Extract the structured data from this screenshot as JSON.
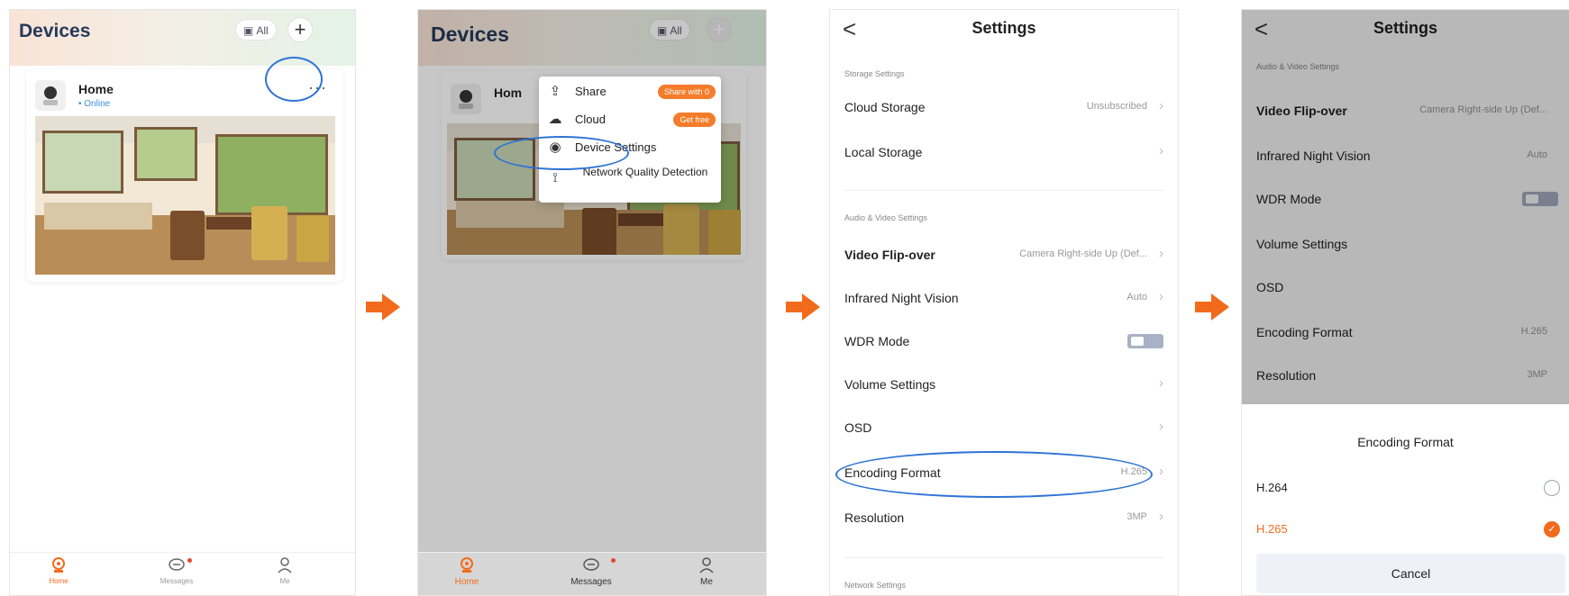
{
  "screen1": {
    "title": "Devices",
    "filter_label": "All",
    "add_label": "+",
    "device": {
      "name": "Home",
      "status": "• Online",
      "more": "···"
    },
    "tabs": [
      {
        "label": "Home"
      },
      {
        "label": "Messages"
      },
      {
        "label": "Me"
      }
    ]
  },
  "screen2": {
    "title": "Devices",
    "filter_label": "All",
    "device_name": "Hom",
    "menu": [
      {
        "label": "Share",
        "badge": "Share with 0"
      },
      {
        "label": "Cloud",
        "badge": "Get free"
      },
      {
        "label": "Device Settings"
      },
      {
        "label": "Network Quality Detection"
      }
    ],
    "tabs": [
      {
        "label": "Home"
      },
      {
        "label": "Messages"
      },
      {
        "label": "Me"
      }
    ]
  },
  "screen3": {
    "back": "<",
    "title": "Settings",
    "storage_header": "Storage Settings",
    "cloud_storage": {
      "label": "Cloud Storage",
      "value": "Unsubscribed"
    },
    "local_storage": {
      "label": "Local Storage"
    },
    "av_header": "Audio & Video Settings",
    "video_flip": {
      "label": "Video Flip-over",
      "value": "Camera Right-side Up (Def..."
    },
    "infrared": {
      "label": "Infrared Night Vision",
      "value": "Auto"
    },
    "wdr": {
      "label": "WDR Mode"
    },
    "volume": {
      "label": "Volume Settings"
    },
    "osd": {
      "label": "OSD"
    },
    "encoding": {
      "label": "Encoding Format",
      "value": "H.265"
    },
    "resolution": {
      "label": "Resolution",
      "value": "3MP"
    },
    "network_header": "Network Settings"
  },
  "screen4": {
    "back": "<",
    "title": "Settings",
    "av_header": "Audio & Video Settings",
    "video_flip": {
      "label": "Video Flip-over",
      "value": "Camera Right-side Up (Def..."
    },
    "infrared": {
      "label": "Infrared Night Vision",
      "value": "Auto"
    },
    "wdr": {
      "label": "WDR Mode"
    },
    "volume": {
      "label": "Volume Settings"
    },
    "osd": {
      "label": "OSD"
    },
    "encoding": {
      "label": "Encoding Format",
      "value": "H.265"
    },
    "resolution": {
      "label": "Resolution",
      "value": "3MP"
    },
    "sheet": {
      "title": "Encoding Format",
      "options": [
        {
          "label": "H.264",
          "selected": false
        },
        {
          "label": "H.265",
          "selected": true
        }
      ],
      "cancel": "Cancel"
    }
  },
  "colors": {
    "accent": "#f26b1d",
    "highlight": "#2f73d6",
    "title_dark": "#263a5b"
  },
  "icons": [
    "camera-icon",
    "more-icon",
    "share-icon",
    "cloud-icon",
    "eye-icon",
    "signal-icon",
    "home-icon",
    "messages-icon",
    "me-icon",
    "chevron-right-icon",
    "back-icon",
    "arrow-right-icon"
  ]
}
